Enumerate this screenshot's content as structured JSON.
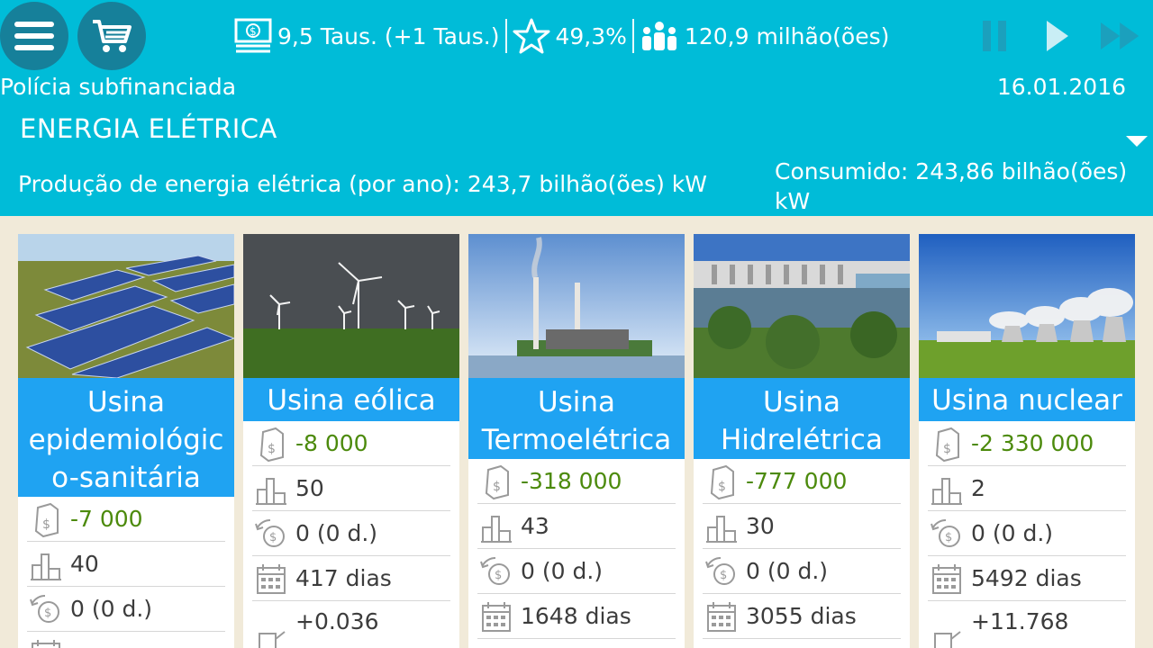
{
  "header": {
    "money": "9,5 Taus. (+1 Taus.)",
    "rating": "49,3%",
    "population": "120,9 milhão(ões)",
    "problem": "Polícia subfinanciada",
    "date": "16.01.2016",
    "section_title": "ENERGIA ELÉTRICA",
    "production": "Produção de energia elétrica (por ano): 243,7 bilhão(ões) kW",
    "consumed": "Consumido: 243,86 bilhão(ões) kW"
  },
  "colors": {
    "header_bg": "#00bcd8",
    "card_title_bg": "#1fa3f2",
    "value_green": "#4c8a0c",
    "page_bg": "#f1ead9"
  },
  "cards": [
    {
      "name": "Usina epidemiológic o-sanitária",
      "cost": "-7 000",
      "count": "40",
      "upkeep": "0 (0 d.)",
      "build_time": "",
      "extra": ""
    },
    {
      "name": "Usina eólica",
      "cost": "-8 000",
      "count": "50",
      "upkeep": "0 (0 d.)",
      "build_time": "417 dias",
      "extra": "+0.036"
    },
    {
      "name": "Usina Termoelétrica",
      "cost": "-318 000",
      "count": "43",
      "upkeep": "0 (0 d.)",
      "build_time": "1648 dias",
      "extra": ""
    },
    {
      "name": "Usina Hidrelétrica",
      "cost": "-777 000",
      "count": "30",
      "upkeep": "0 (0 d.)",
      "build_time": "3055 dias",
      "extra": ""
    },
    {
      "name": "Usina nuclear",
      "cost": "-2 330 000",
      "count": "2",
      "upkeep": "0 (0 d.)",
      "build_time": "5492 dias",
      "extra": "+11.768"
    }
  ]
}
